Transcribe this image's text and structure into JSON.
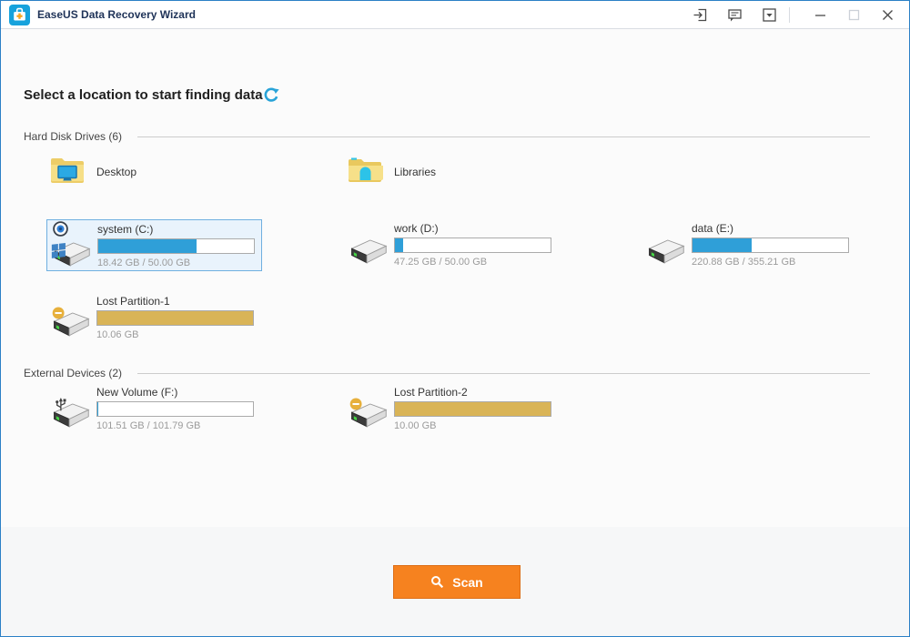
{
  "titlebar": {
    "app_title": "EaseUS Data Recovery Wizard",
    "icons": [
      "app-logo-icon",
      "signin-icon",
      "feedback-icon",
      "chevron-down-icon",
      "minimize-icon",
      "maximize-icon",
      "close-icon"
    ]
  },
  "header": {
    "title": "Select a location to start finding data",
    "refresh_icon": "refresh-icon"
  },
  "sections": [
    {
      "label": "Hard Disk Drives (6)",
      "items": [
        {
          "name": "Desktop",
          "icon": "desktop-folder-icon"
        },
        {
          "name": "Libraries",
          "icon": "libraries-folder-icon"
        },
        {
          "name": "system (C:)",
          "icon": "windows-drive-icon",
          "size": "18.42 GB / 50.00 GB",
          "used_percent": 63,
          "bar_color": "#2f9fd8",
          "selected": true
        },
        {
          "name": "work (D:)",
          "icon": "drive-icon",
          "size": "47.25 GB / 50.00 GB",
          "used_percent": 5.5,
          "bar_color": "#2f9fd8",
          "selected": false
        },
        {
          "name": "data (E:)",
          "icon": "drive-icon",
          "size": "220.88 GB / 355.21 GB",
          "used_percent": 38,
          "bar_color": "#2f9fd8",
          "selected": false
        },
        {
          "name": "Lost Partition-1",
          "icon": "lost-partition-drive-icon",
          "size": "10.06 GB",
          "used_percent": 100,
          "bar_color": "#d9b457",
          "selected": false
        }
      ]
    },
    {
      "label": "External Devices (2)",
      "items": [
        {
          "name": "New Volume (F:)",
          "icon": "usb-drive-icon",
          "size": "101.51 GB / 101.79 GB",
          "used_percent": 0.3,
          "bar_color": "#2f9fd8",
          "selected": false
        },
        {
          "name": "Lost Partition-2",
          "icon": "lost-partition-drive-icon",
          "size": "10.00 GB",
          "used_percent": 100,
          "bar_color": "#d9b457",
          "selected": false
        }
      ]
    }
  ],
  "scan_button": {
    "label": "Scan",
    "icon": "search-icon"
  },
  "colors": {
    "window_border": "#2b80c6",
    "accent_blue": "#2f9fd8",
    "lost_gold": "#d9b457",
    "scan_orange": "#f6821f",
    "selection_bg": "#e9f3fc",
    "selection_border": "#6fafe0",
    "title_text": "#1f3358"
  }
}
